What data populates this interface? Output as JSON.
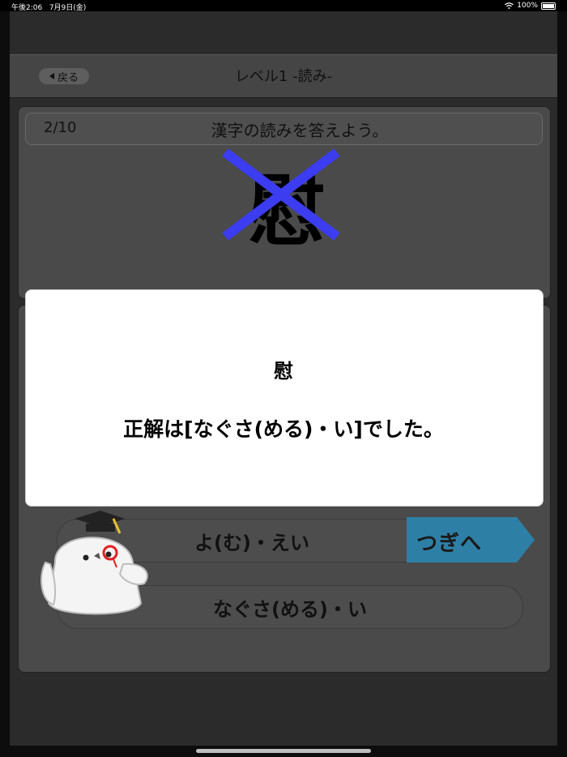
{
  "status_bar": {
    "time": "午後2:06",
    "date": "7月9日(金)",
    "battery": "100%"
  },
  "nav": {
    "back_label": "戻る",
    "title": "レベル1 -読み-"
  },
  "question": {
    "counter": "2/10",
    "prompt": "漢字の読みを答えよう。",
    "kanji": "慰",
    "result_mark": "incorrect-cross"
  },
  "choices": [
    {
      "label": "よ(む)・えい"
    },
    {
      "label": "なぐさ(める)・い"
    }
  ],
  "next_button": {
    "label": "つぎへ"
  },
  "modal": {
    "kanji": "慰",
    "message": "正解は[なぐさ(める)・い]でした。"
  },
  "colors": {
    "cross": "#3c3cf0",
    "next_button": "#2e7fa6",
    "background": "#2b2b2b"
  }
}
